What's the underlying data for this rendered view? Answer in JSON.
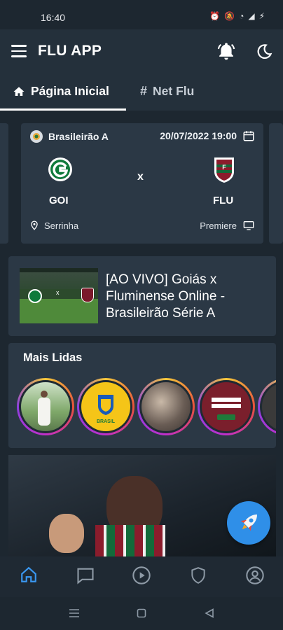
{
  "status_bar": {
    "time": "16:40"
  },
  "app_bar": {
    "title": "FLU APP",
    "menu_icon": "menu-icon",
    "notification_icon": "bell-icon",
    "theme_icon": "moon-icon"
  },
  "tabs": [
    {
      "label": "Página Inicial",
      "icon": "home-icon",
      "active": true
    },
    {
      "label": "Net Flu",
      "icon": "hash-icon",
      "active": false
    }
  ],
  "match_card": {
    "league": "Brasileirão A",
    "datetime": "20/07/2022 19:00",
    "home_team": "GOI",
    "vs": "x",
    "away_team": "FLU",
    "venue": "Serrinha",
    "broadcaster": "Premiere"
  },
  "live_news": {
    "title": "[AO VIVO] Goiás x Fluminense Online - Brasileirão Série A",
    "thumb_vs": "x"
  },
  "mais_lidas": {
    "title": "Mais Lidas",
    "story_thumb_text": "BRASIL"
  },
  "fab": {
    "icon": "rocket-icon"
  },
  "bottom_nav": [
    {
      "icon": "home-icon",
      "active": true
    },
    {
      "icon": "chat-icon",
      "active": false
    },
    {
      "icon": "play-icon",
      "active": false
    },
    {
      "icon": "shield-icon",
      "active": false
    },
    {
      "icon": "account-icon",
      "active": false
    }
  ],
  "colors": {
    "background": "#1d2730",
    "card": "#2b3845",
    "accent": "#2f8fe8",
    "active_nav": "#3a97f0",
    "inactive_nav": "#8e9aa6"
  }
}
